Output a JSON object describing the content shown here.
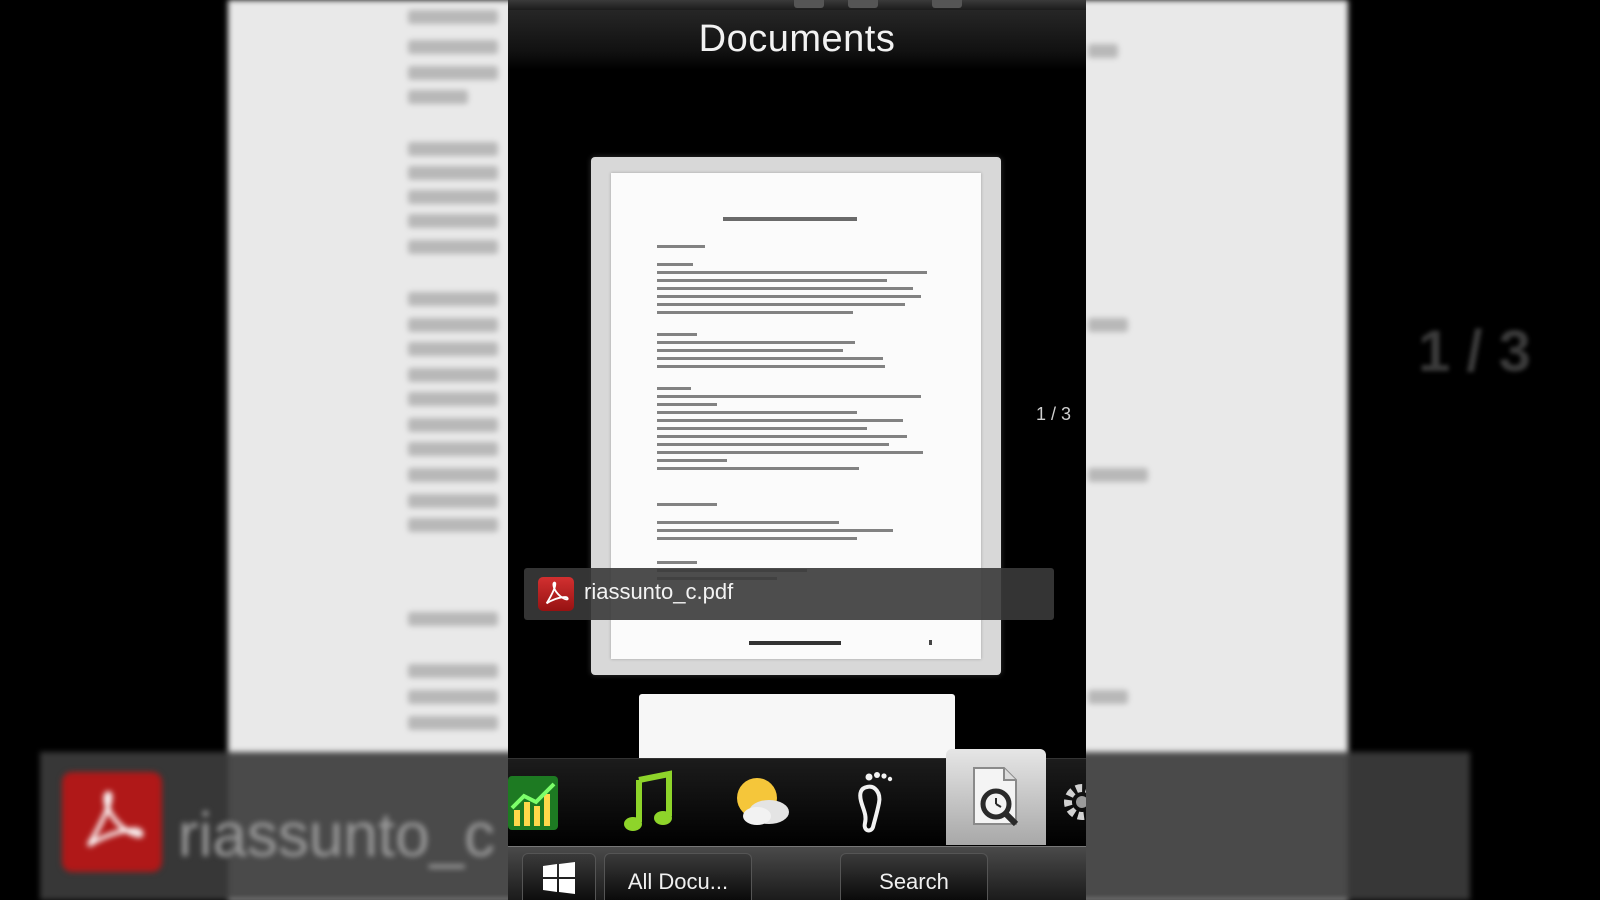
{
  "screen": {
    "title": "Documents",
    "page_indicator": "1 / 3"
  },
  "document": {
    "file_name": "riassunto_c.pdf",
    "file_icon": "pdf-icon"
  },
  "backdrop": {
    "file_name": "riassunto_c",
    "page_indicator": "1 / 3"
  },
  "dock": {
    "tabs": [
      {
        "name": "stocks",
        "icon": "stocks-chart-icon",
        "selected": false
      },
      {
        "name": "music",
        "icon": "music-note-icon",
        "selected": false
      },
      {
        "name": "weather",
        "icon": "weather-sun-cloud-icon",
        "selected": false
      },
      {
        "name": "footprints",
        "icon": "footprints-icon",
        "selected": false
      },
      {
        "name": "documents",
        "icon": "document-search-icon",
        "selected": true
      },
      {
        "name": "settings",
        "icon": "gear-icon",
        "selected": false
      }
    ]
  },
  "bottom_bar": {
    "start_icon": "windows-logo-icon",
    "left_softkey": "All Docu...",
    "right_softkey": "Search"
  },
  "colors": {
    "background": "#000000",
    "pdf_red": "#c42020",
    "selected_tab": "#d4d4d4"
  }
}
